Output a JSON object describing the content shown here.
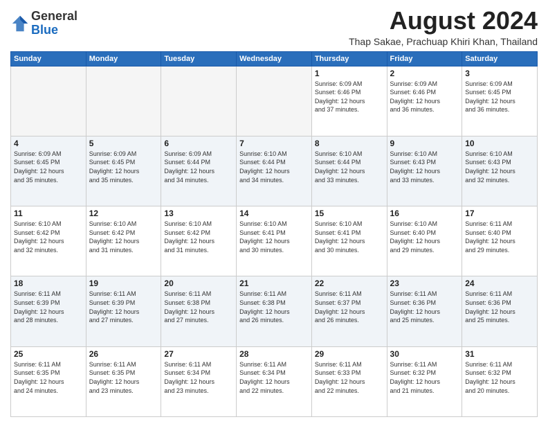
{
  "logo": {
    "line1": "General",
    "line2": "Blue"
  },
  "title": "August 2024",
  "location": "Thap Sakae, Prachuap Khiri Khan, Thailand",
  "days_of_week": [
    "Sunday",
    "Monday",
    "Tuesday",
    "Wednesday",
    "Thursday",
    "Friday",
    "Saturday"
  ],
  "weeks": [
    [
      {
        "day": "",
        "info": "",
        "empty": true
      },
      {
        "day": "",
        "info": "",
        "empty": true
      },
      {
        "day": "",
        "info": "",
        "empty": true
      },
      {
        "day": "",
        "info": "",
        "empty": true
      },
      {
        "day": "1",
        "info": "Sunrise: 6:09 AM\nSunset: 6:46 PM\nDaylight: 12 hours\nand 37 minutes."
      },
      {
        "day": "2",
        "info": "Sunrise: 6:09 AM\nSunset: 6:46 PM\nDaylight: 12 hours\nand 36 minutes."
      },
      {
        "day": "3",
        "info": "Sunrise: 6:09 AM\nSunset: 6:45 PM\nDaylight: 12 hours\nand 36 minutes."
      }
    ],
    [
      {
        "day": "4",
        "info": "Sunrise: 6:09 AM\nSunset: 6:45 PM\nDaylight: 12 hours\nand 35 minutes."
      },
      {
        "day": "5",
        "info": "Sunrise: 6:09 AM\nSunset: 6:45 PM\nDaylight: 12 hours\nand 35 minutes."
      },
      {
        "day": "6",
        "info": "Sunrise: 6:09 AM\nSunset: 6:44 PM\nDaylight: 12 hours\nand 34 minutes."
      },
      {
        "day": "7",
        "info": "Sunrise: 6:10 AM\nSunset: 6:44 PM\nDaylight: 12 hours\nand 34 minutes."
      },
      {
        "day": "8",
        "info": "Sunrise: 6:10 AM\nSunset: 6:44 PM\nDaylight: 12 hours\nand 33 minutes."
      },
      {
        "day": "9",
        "info": "Sunrise: 6:10 AM\nSunset: 6:43 PM\nDaylight: 12 hours\nand 33 minutes."
      },
      {
        "day": "10",
        "info": "Sunrise: 6:10 AM\nSunset: 6:43 PM\nDaylight: 12 hours\nand 32 minutes."
      }
    ],
    [
      {
        "day": "11",
        "info": "Sunrise: 6:10 AM\nSunset: 6:42 PM\nDaylight: 12 hours\nand 32 minutes."
      },
      {
        "day": "12",
        "info": "Sunrise: 6:10 AM\nSunset: 6:42 PM\nDaylight: 12 hours\nand 31 minutes."
      },
      {
        "day": "13",
        "info": "Sunrise: 6:10 AM\nSunset: 6:42 PM\nDaylight: 12 hours\nand 31 minutes."
      },
      {
        "day": "14",
        "info": "Sunrise: 6:10 AM\nSunset: 6:41 PM\nDaylight: 12 hours\nand 30 minutes."
      },
      {
        "day": "15",
        "info": "Sunrise: 6:10 AM\nSunset: 6:41 PM\nDaylight: 12 hours\nand 30 minutes."
      },
      {
        "day": "16",
        "info": "Sunrise: 6:10 AM\nSunset: 6:40 PM\nDaylight: 12 hours\nand 29 minutes."
      },
      {
        "day": "17",
        "info": "Sunrise: 6:11 AM\nSunset: 6:40 PM\nDaylight: 12 hours\nand 29 minutes."
      }
    ],
    [
      {
        "day": "18",
        "info": "Sunrise: 6:11 AM\nSunset: 6:39 PM\nDaylight: 12 hours\nand 28 minutes."
      },
      {
        "day": "19",
        "info": "Sunrise: 6:11 AM\nSunset: 6:39 PM\nDaylight: 12 hours\nand 27 minutes."
      },
      {
        "day": "20",
        "info": "Sunrise: 6:11 AM\nSunset: 6:38 PM\nDaylight: 12 hours\nand 27 minutes."
      },
      {
        "day": "21",
        "info": "Sunrise: 6:11 AM\nSunset: 6:38 PM\nDaylight: 12 hours\nand 26 minutes."
      },
      {
        "day": "22",
        "info": "Sunrise: 6:11 AM\nSunset: 6:37 PM\nDaylight: 12 hours\nand 26 minutes."
      },
      {
        "day": "23",
        "info": "Sunrise: 6:11 AM\nSunset: 6:36 PM\nDaylight: 12 hours\nand 25 minutes."
      },
      {
        "day": "24",
        "info": "Sunrise: 6:11 AM\nSunset: 6:36 PM\nDaylight: 12 hours\nand 25 minutes."
      }
    ],
    [
      {
        "day": "25",
        "info": "Sunrise: 6:11 AM\nSunset: 6:35 PM\nDaylight: 12 hours\nand 24 minutes."
      },
      {
        "day": "26",
        "info": "Sunrise: 6:11 AM\nSunset: 6:35 PM\nDaylight: 12 hours\nand 23 minutes."
      },
      {
        "day": "27",
        "info": "Sunrise: 6:11 AM\nSunset: 6:34 PM\nDaylight: 12 hours\nand 23 minutes."
      },
      {
        "day": "28",
        "info": "Sunrise: 6:11 AM\nSunset: 6:34 PM\nDaylight: 12 hours\nand 22 minutes."
      },
      {
        "day": "29",
        "info": "Sunrise: 6:11 AM\nSunset: 6:33 PM\nDaylight: 12 hours\nand 22 minutes."
      },
      {
        "day": "30",
        "info": "Sunrise: 6:11 AM\nSunset: 6:32 PM\nDaylight: 12 hours\nand 21 minutes."
      },
      {
        "day": "31",
        "info": "Sunrise: 6:11 AM\nSunset: 6:32 PM\nDaylight: 12 hours\nand 20 minutes."
      }
    ]
  ]
}
